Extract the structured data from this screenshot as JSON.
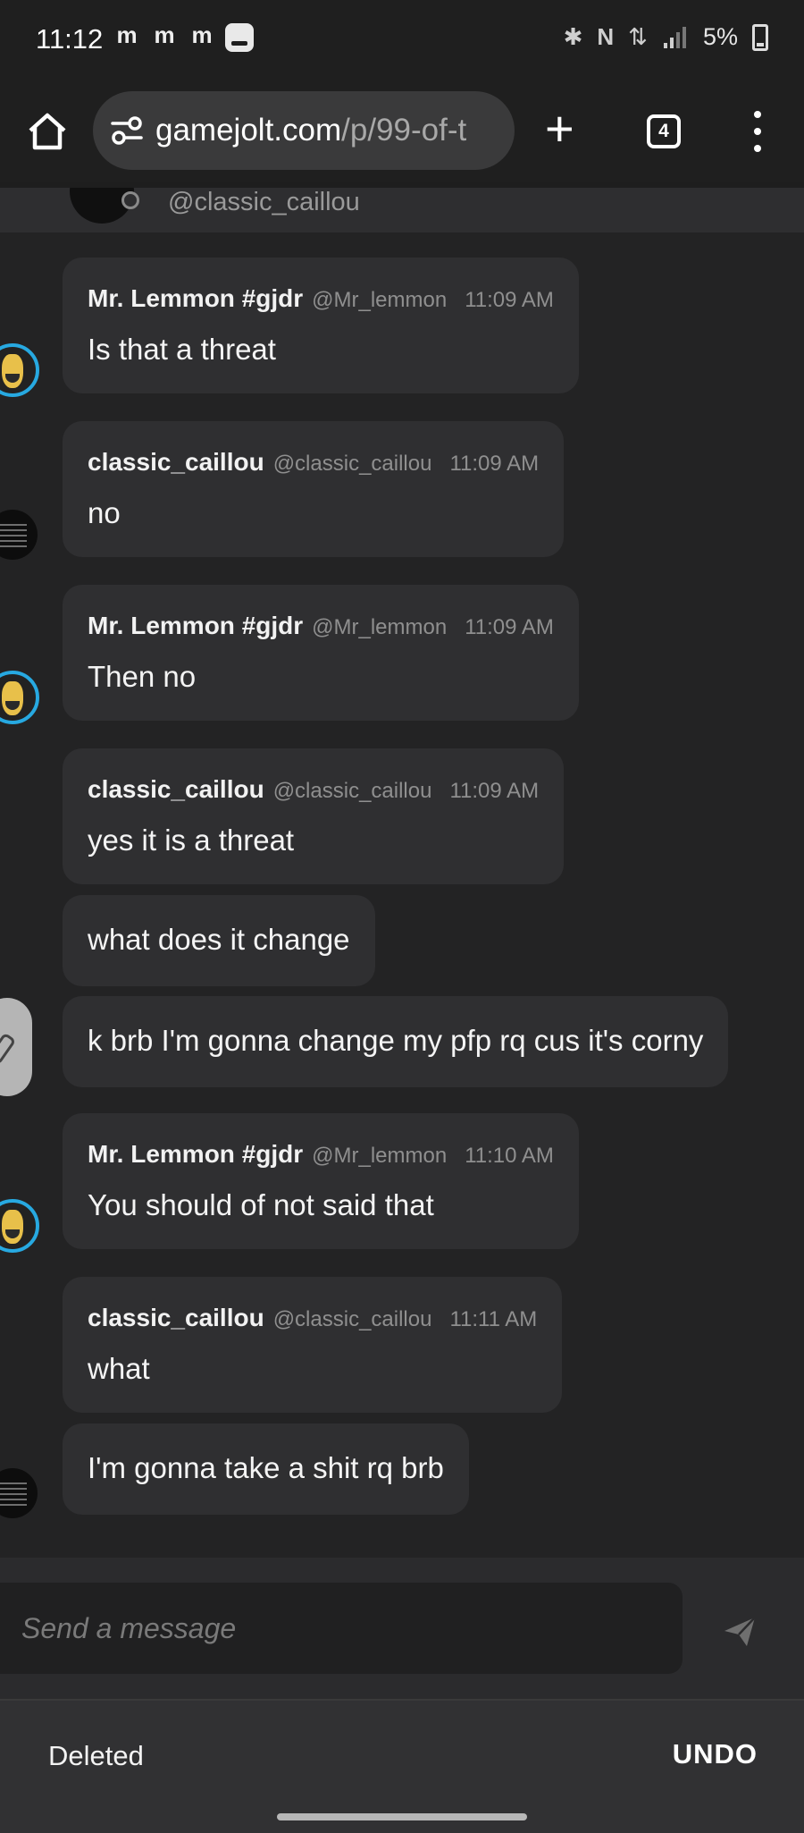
{
  "status_bar": {
    "time": "11:12",
    "notification_icons": [
      "m",
      "m",
      "m"
    ],
    "battery": "5%"
  },
  "browser": {
    "url_domain": "gamejolt.com",
    "url_path": "/p/99-of-t",
    "tab_count": "4"
  },
  "pinned": {
    "handle": "@classic_caillou"
  },
  "messages": [
    {
      "name": "Mr. Lemmon #gjdr",
      "handle": "@Mr_lemmon",
      "time": "11:09 AM",
      "text": "Is that a threat"
    },
    {
      "name": "classic_caillou",
      "handle": "@classic_caillou",
      "time": "11:09 AM",
      "text": "no"
    },
    {
      "name": "Mr. Lemmon #gjdr",
      "handle": "@Mr_lemmon",
      "time": "11:09 AM",
      "text": "Then no"
    },
    {
      "name": "classic_caillou",
      "handle": "@classic_caillou",
      "time": "11:09 AM",
      "text": "yes it is a threat"
    },
    {
      "text": "what does it change"
    },
    {
      "text": "k brb I'm gonna change my pfp rq cus it's corny"
    },
    {
      "name": "Mr. Lemmon #gjdr",
      "handle": "@Mr_lemmon",
      "time": "11:10 AM",
      "text": "You should of not said that"
    },
    {
      "name": "classic_caillou",
      "handle": "@classic_caillou",
      "time": "11:11 AM",
      "text": "what"
    },
    {
      "text": "I'm gonna take a shit rq brb"
    }
  ],
  "composer": {
    "placeholder": "Send a message"
  },
  "snackbar": {
    "text": "Deleted",
    "action": "UNDO"
  },
  "colors": {
    "background": "#232324",
    "bubble": "#2f2f31",
    "lemmon_ring": "#27a9e1"
  }
}
